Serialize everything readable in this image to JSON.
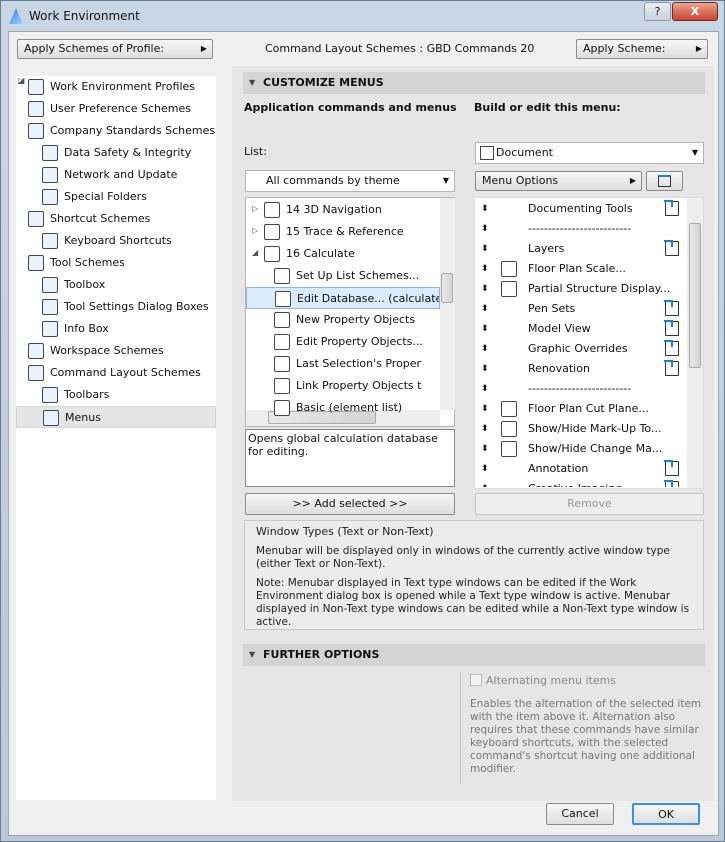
{
  "window": {
    "title": "Work Environment",
    "help": "?",
    "close": "X"
  },
  "top": {
    "apply_profile": "Apply Schemes of Profile:",
    "scheme_label": "Command Layout Schemes :",
    "scheme_value": "GBD Commands 20",
    "apply_scheme": "Apply Scheme:"
  },
  "tree": [
    {
      "label": "Work Environment Profiles",
      "level": 0,
      "icon": "profile-icon"
    },
    {
      "label": "User Preference Schemes",
      "level": 0,
      "icon": "user-pref-icon",
      "toggle": "collapsed"
    },
    {
      "label": "Company Standards Schemes",
      "level": 0,
      "icon": "company-icon",
      "toggle": "expanded"
    },
    {
      "label": "Data Safety & Integrity",
      "level": 1,
      "icon": "data-safety-icon"
    },
    {
      "label": "Network and Update",
      "level": 1,
      "icon": "globe-icon"
    },
    {
      "label": "Special Folders",
      "level": 1,
      "icon": "folder-icon"
    },
    {
      "label": "Shortcut Schemes",
      "level": 0,
      "icon": "shortcut-icon",
      "toggle": "expanded"
    },
    {
      "label": "Keyboard Shortcuts",
      "level": 1,
      "icon": "keyboard-icon"
    },
    {
      "label": "Tool Schemes",
      "level": 0,
      "icon": "tool-icon",
      "toggle": "expanded"
    },
    {
      "label": "Toolbox",
      "level": 1,
      "icon": "toolbox-icon"
    },
    {
      "label": "Tool Settings Dialog Boxes",
      "level": 1,
      "icon": "tool-settings-icon"
    },
    {
      "label": "Info Box",
      "level": 1,
      "icon": "info-box-icon"
    },
    {
      "label": "Workspace Schemes",
      "level": 0,
      "icon": "workspace-icon"
    },
    {
      "label": "Command Layout Schemes",
      "level": 0,
      "icon": "command-layout-icon",
      "toggle": "expanded"
    },
    {
      "label": "Toolbars",
      "level": 1,
      "icon": "toolbars-icon"
    },
    {
      "label": "Menus",
      "level": 1,
      "icon": "menus-icon",
      "selected": true
    }
  ],
  "customize": {
    "section": "CUSTOMIZE MENUS",
    "app_heading": "Application commands and menus",
    "build_heading": "Build or edit this menu:",
    "list_label": "List:",
    "list_value": "All commands by theme",
    "menu_value": "Document",
    "menu_options": "Menu Options",
    "commands": [
      {
        "label": "14 3D Navigation",
        "level": 0,
        "toggle": "collapsed"
      },
      {
        "label": "15 Trace & Reference",
        "level": 0,
        "toggle": "collapsed"
      },
      {
        "label": "16 Calculate",
        "level": 0,
        "toggle": "expanded"
      },
      {
        "label": "Set Up List Schemes...",
        "level": 1
      },
      {
        "label": "Edit Database... (calculate)",
        "level": 1,
        "selected": true
      },
      {
        "label": "New Property Objects",
        "level": 1
      },
      {
        "label": "Edit Property Objects...",
        "level": 1
      },
      {
        "label": "Last Selection's Property Ob",
        "level": 1
      },
      {
        "label": "Link Property Objects to Cri",
        "level": 1
      },
      {
        "label": "Basic (element list)",
        "level": 1
      }
    ],
    "description": "Opens global calculation database for editing.",
    "add_selected": ">> Add selected >>",
    "remove": "Remove",
    "menu_items": [
      {
        "label": "Documenting Tools",
        "submenu": true
      },
      {
        "label": "--------------------------"
      },
      {
        "label": "Layers",
        "submenu": true
      },
      {
        "label": "Floor Plan Scale...",
        "icon": "scale-icon"
      },
      {
        "label": "Partial Structure Display...",
        "icon": "hatch-icon"
      },
      {
        "label": "Pen Sets",
        "submenu": true
      },
      {
        "label": "Model View",
        "submenu": true
      },
      {
        "label": "Graphic Overrides",
        "submenu": true
      },
      {
        "label": "Renovation",
        "submenu": true
      },
      {
        "label": "--------------------------"
      },
      {
        "label": "Floor Plan Cut Plane...",
        "icon": "cut-plane-icon"
      },
      {
        "label": "Show/Hide Mark-Up To...",
        "icon": "markup-icon"
      },
      {
        "label": "Show/Hide Change Ma...",
        "icon": "change-icon"
      },
      {
        "label": "Annotation",
        "submenu": true
      },
      {
        "label": "Creative Imaging",
        "submenu": true
      }
    ],
    "window_types": {
      "title": "Window Types (Text or Non-Text)",
      "p1": "Menubar will be displayed only in windows of the currently active window type (either Text or Non-Text).",
      "p2": "Note: Menubar displayed in Text type windows can be edited if the Work Environment dialog box is opened while a Text type window is active. Menubar displayed in Non-Text type windows can be edited while a Non-Text type window is active."
    }
  },
  "further": {
    "section": "FURTHER OPTIONS",
    "checkbox": "Alternating menu items",
    "checked": false,
    "desc": "Enables the alternation of the selected item with the item above it. Alternation also requires that these commands have similar keyboard shortcuts, with the selected command's shortcut having one additional modifier."
  },
  "footer": {
    "cancel": "Cancel",
    "ok": "OK"
  }
}
